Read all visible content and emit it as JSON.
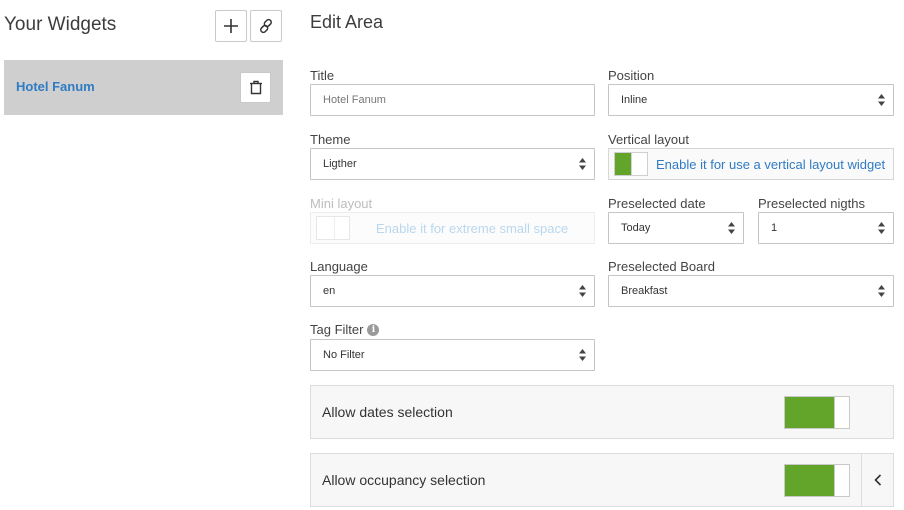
{
  "sidebar": {
    "title": "Your Widgets",
    "add_icon": "plus-icon",
    "link_icon": "link-icon",
    "widgets": [
      {
        "name": "Hotel Fanum",
        "delete_icon": "trash-icon"
      }
    ]
  },
  "editor": {
    "title": "Edit Area",
    "fields": {
      "title": {
        "label": "Title",
        "value": "Hotel Fanum"
      },
      "position": {
        "label": "Position",
        "value": "Inline"
      },
      "theme": {
        "label": "Theme",
        "value": "Ligther"
      },
      "vertical_layout": {
        "label": "Vertical layout",
        "text": "Enable it for use a vertical layout widget",
        "enabled": true
      },
      "mini_layout": {
        "label": "Mini layout",
        "text": "Enable it for extreme small space",
        "enabled": false,
        "disabled": true
      },
      "preselected_date": {
        "label": "Preselected date",
        "value": "Today"
      },
      "preselected_nights": {
        "label": "Preselected nigths",
        "value": "1"
      },
      "language": {
        "label": "Language",
        "value": "en"
      },
      "preselected_board": {
        "label": "Preselected Board",
        "value": "Breakfast"
      },
      "tag_filter": {
        "label": "Tag Filter",
        "value": "No Filter",
        "info_icon": "info-icon"
      }
    },
    "sections": [
      {
        "label": "Allow dates selection",
        "enabled": true
      },
      {
        "label": "Allow occupancy selection",
        "enabled": true,
        "chevron_icon": "chevron-left-icon"
      }
    ]
  },
  "colors": {
    "accent_blue": "#2f7bc4",
    "toggle_green": "#63a52a",
    "selected_item_bg": "#cfcfcf"
  }
}
